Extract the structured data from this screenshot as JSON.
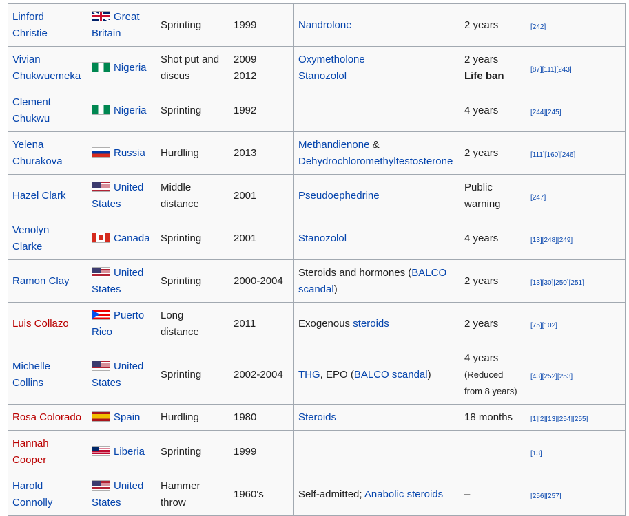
{
  "rows": [
    {
      "name": [
        "Linford",
        "Christie"
      ],
      "name_color": "blue",
      "flag": "flag-gb",
      "country": [
        "Great",
        "Britain"
      ],
      "event": [
        "Sprinting"
      ],
      "year": [
        "1999"
      ],
      "substance": [
        [
          {
            "t": "Nandrolone",
            "l": true
          }
        ]
      ],
      "penalty": [
        {
          "t": "2 years"
        }
      ],
      "refs": "[242]",
      "tall": true
    },
    {
      "name": [
        "Vivian",
        "Chukwuemeka"
      ],
      "name_color": "blue",
      "flag": "flag-ng",
      "country": [
        "Nigeria"
      ],
      "event": [
        "Shot put and",
        "discus"
      ],
      "year": [
        "2009",
        "2012"
      ],
      "substance": [
        [
          {
            "t": "Oxymetholone",
            "l": true
          }
        ],
        [
          {
            "t": "Stanozolol",
            "l": true
          }
        ]
      ],
      "penalty": [
        {
          "t": "2 years"
        },
        {
          "t": "Life ban",
          "b": true
        }
      ],
      "refs": "[87][111][243]",
      "tall": true
    },
    {
      "name": [
        "Clement",
        "Chukwu"
      ],
      "name_color": "blue",
      "flag": "flag-ng",
      "country": [
        "Nigeria"
      ],
      "event": [
        "Sprinting"
      ],
      "year": [
        "1992"
      ],
      "substance": [],
      "penalty": [
        {
          "t": "4 years"
        }
      ],
      "refs": "[244][245]",
      "tall": true
    },
    {
      "name": [
        "Yelena",
        "Churakova"
      ],
      "name_color": "blue",
      "flag": "flag-ru",
      "country": [
        "Russia"
      ],
      "event": [
        "Hurdling"
      ],
      "year": [
        "2013"
      ],
      "substance": [
        [
          {
            "t": "Methandienone",
            "l": true
          },
          {
            "t": " &",
            "l": false
          }
        ],
        [
          {
            "t": "Dehydrochloromethyltestosterone",
            "l": true
          }
        ]
      ],
      "penalty": [
        {
          "t": "2 years"
        }
      ],
      "refs": "[111][160][246]",
      "tall": true
    },
    {
      "name": [
        "Hazel Clark"
      ],
      "name_color": "blue",
      "flag": "flag-us",
      "country": [
        "United",
        "States"
      ],
      "event": [
        "Middle",
        "distance"
      ],
      "year": [
        "2001"
      ],
      "substance": [
        [
          {
            "t": "Pseudoephedrine",
            "l": true
          }
        ]
      ],
      "penalty": [
        {
          "t": "Public"
        },
        {
          "t": "warning"
        }
      ],
      "refs": "[247]",
      "tall": true
    },
    {
      "name": [
        "Venolyn",
        "Clarke"
      ],
      "name_color": "blue",
      "flag": "flag-ca",
      "country": [
        "Canada"
      ],
      "event": [
        "Sprinting"
      ],
      "year": [
        "2001"
      ],
      "substance": [
        [
          {
            "t": "Stanozolol",
            "l": true
          }
        ]
      ],
      "penalty": [
        {
          "t": "4 years"
        }
      ],
      "refs": "[13][248][249]",
      "tall": true
    },
    {
      "name": [
        "Ramon Clay"
      ],
      "name_color": "blue",
      "flag": "flag-us",
      "country": [
        "United",
        "States"
      ],
      "event": [
        "Sprinting"
      ],
      "year": [
        "2000-2004"
      ],
      "substance": [
        [
          {
            "t": "Steroids and hormones (",
            "l": false
          },
          {
            "t": "BALCO",
            "l": true
          }
        ],
        [
          {
            "t": "scandal",
            "l": true
          },
          {
            "t": ")",
            "l": false
          }
        ]
      ],
      "penalty": [
        {
          "t": "2 years"
        }
      ],
      "refs": "[13][30][250][251]",
      "tall": true
    },
    {
      "name": [
        "Luis Collazo"
      ],
      "name_color": "red",
      "flag": "flag-pr",
      "country": [
        "Puerto",
        "Rico"
      ],
      "event": [
        "Long",
        "distance"
      ],
      "year": [
        "2011"
      ],
      "substance": [
        [
          {
            "t": "Exogenous ",
            "l": false
          },
          {
            "t": "steroids",
            "l": true
          }
        ]
      ],
      "penalty": [
        {
          "t": "2 years"
        }
      ],
      "refs": "[75][102]",
      "tall": true
    },
    {
      "name": [
        "Michelle",
        "Collins"
      ],
      "name_color": "blue",
      "flag": "flag-us",
      "country": [
        "United",
        "States"
      ],
      "event": [
        "Sprinting"
      ],
      "year": [
        "2002-2004"
      ],
      "substance": [
        [
          {
            "t": "THG",
            "l": true
          },
          {
            "t": ", EPO (",
            "l": false
          },
          {
            "t": "BALCO scandal",
            "l": true
          },
          {
            "t": ")",
            "l": false
          }
        ]
      ],
      "penalty": [
        {
          "t": "4 years"
        },
        {
          "t": "(Reduced",
          "s": true
        },
        {
          "t": "from 8 years)",
          "s": true
        }
      ],
      "refs": "[43][252][253]",
      "tall": true,
      "xtall": true
    },
    {
      "name": [
        "Rosa Colorado"
      ],
      "name_color": "red",
      "flag": "flag-es",
      "country": [
        "Spain"
      ],
      "event": [
        "Hurdling"
      ],
      "year": [
        "1980"
      ],
      "substance": [
        [
          {
            "t": "Steroids",
            "l": true
          }
        ]
      ],
      "penalty": [
        {
          "t": "18 months"
        }
      ],
      "refs": "[1][2][13][254][255]",
      "tall": false
    },
    {
      "name": [
        "Hannah",
        "Cooper"
      ],
      "name_color": "red",
      "flag": "flag-lr",
      "country": [
        "Liberia"
      ],
      "event": [
        "Sprinting"
      ],
      "year": [
        "1999"
      ],
      "substance": [],
      "penalty": [],
      "refs": "[13]",
      "tall": true
    },
    {
      "name": [
        "Harold",
        "Connolly"
      ],
      "name_color": "blue",
      "flag": "flag-us",
      "country": [
        "United",
        "States"
      ],
      "event": [
        "Hammer",
        "throw"
      ],
      "year": [
        "1960's"
      ],
      "substance": [
        [
          {
            "t": "Self-admitted; ",
            "l": false
          },
          {
            "t": "Anabolic steroids",
            "l": true
          }
        ]
      ],
      "penalty": [
        {
          "t": "–"
        }
      ],
      "refs": "[256][257]",
      "tall": true
    }
  ],
  "colors": {
    "link": "#0645ad",
    "redlink": "#ba0000",
    "border": "#a2a9b1",
    "cell_bg": "#f9f9f9"
  }
}
